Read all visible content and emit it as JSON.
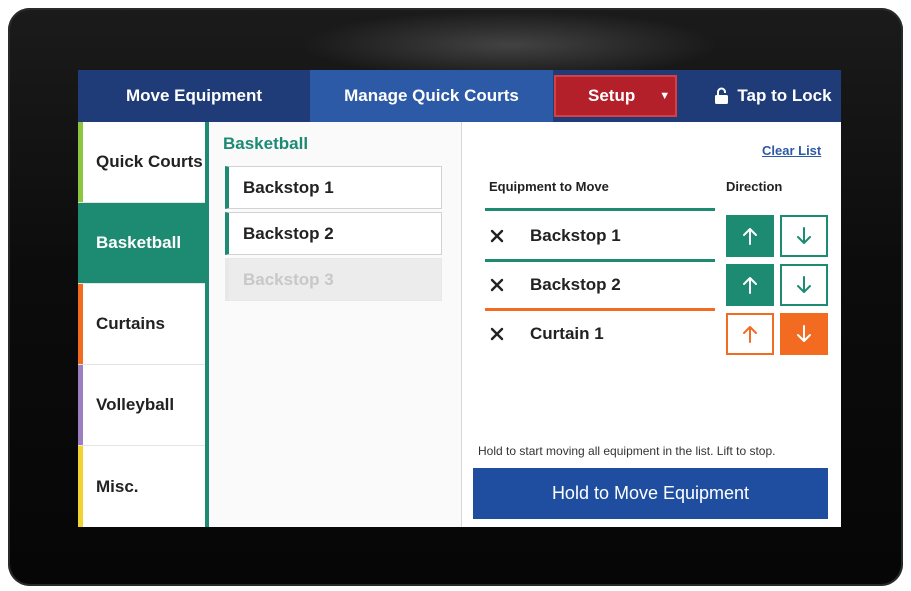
{
  "topbar": {
    "tab_move": "Move Equipment",
    "tab_manage": "Manage Quick Courts",
    "setup": "Setup",
    "lock": "Tap to Lock"
  },
  "sidebar": {
    "items": [
      {
        "label": "Quick Courts",
        "color": "#8cc63f",
        "active": false
      },
      {
        "label": "Basketball",
        "color": "#1d8a72",
        "active": true
      },
      {
        "label": "Curtains",
        "color": "#f26b21",
        "active": false
      },
      {
        "label": "Volleyball",
        "color": "#9b7fc0",
        "active": false
      },
      {
        "label": "Misc.",
        "color": "#f2d22e",
        "active": false
      }
    ]
  },
  "middle": {
    "title": "Basketball",
    "items": [
      {
        "label": "Backstop 1",
        "enabled": true
      },
      {
        "label": "Backstop 2",
        "enabled": true
      },
      {
        "label": "Backstop 3",
        "enabled": false
      }
    ]
  },
  "right": {
    "clear_list": "Clear List",
    "col_equipment": "Equipment to Move",
    "col_direction": "Direction",
    "rows": [
      {
        "label": "Backstop 1",
        "color": "#1d8a72",
        "direction": "up"
      },
      {
        "label": "Backstop 2",
        "color": "#1d8a72",
        "direction": "up"
      },
      {
        "label": "Curtain 1",
        "color": "#f26b21",
        "direction": "down"
      }
    ],
    "hint": "Hold to start moving all equipment in the list. Lift to stop.",
    "hold_button": "Hold to Move Equipment"
  },
  "colors": {
    "nav_dark": "#1f3c78",
    "nav_active": "#2d5aa6",
    "setup_red": "#b3202a",
    "teal": "#1d8a72",
    "orange": "#f26b21",
    "primary_blue": "#1f4ea0"
  }
}
